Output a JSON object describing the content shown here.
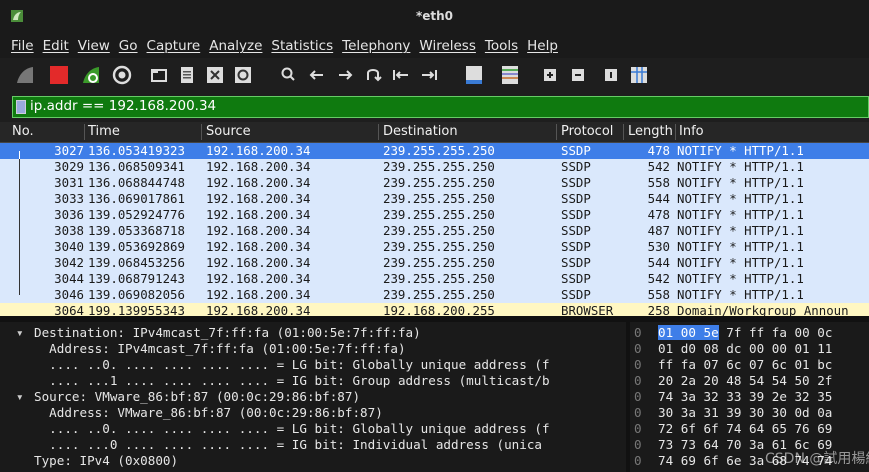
{
  "window": {
    "title": "*eth0"
  },
  "menu": [
    "File",
    "Edit",
    "View",
    "Go",
    "Capture",
    "Analyze",
    "Statistics",
    "Telephony",
    "Wireless",
    "Tools",
    "Help"
  ],
  "filter": {
    "value": "ip.addr == 192.168.200.34"
  },
  "columns": {
    "no": "No.",
    "time": "Time",
    "source": "Source",
    "destination": "Destination",
    "protocol": "Protocol",
    "length": "Length",
    "info": "Info"
  },
  "packets": [
    {
      "no": "3027",
      "time": "136.053419323",
      "source": "192.168.200.34",
      "destination": "239.255.255.250",
      "protocol": "SSDP",
      "length": "478",
      "info": "NOTIFY * HTTP/1.1"
    },
    {
      "no": "3029",
      "time": "136.068509341",
      "source": "192.168.200.34",
      "destination": "239.255.255.250",
      "protocol": "SSDP",
      "length": "542",
      "info": "NOTIFY * HTTP/1.1"
    },
    {
      "no": "3031",
      "time": "136.068844748",
      "source": "192.168.200.34",
      "destination": "239.255.255.250",
      "protocol": "SSDP",
      "length": "558",
      "info": "NOTIFY * HTTP/1.1"
    },
    {
      "no": "3033",
      "time": "136.069017861",
      "source": "192.168.200.34",
      "destination": "239.255.255.250",
      "protocol": "SSDP",
      "length": "544",
      "info": "NOTIFY * HTTP/1.1"
    },
    {
      "no": "3036",
      "time": "139.052924776",
      "source": "192.168.200.34",
      "destination": "239.255.255.250",
      "protocol": "SSDP",
      "length": "478",
      "info": "NOTIFY * HTTP/1.1"
    },
    {
      "no": "3038",
      "time": "139.053368718",
      "source": "192.168.200.34",
      "destination": "239.255.255.250",
      "protocol": "SSDP",
      "length": "487",
      "info": "NOTIFY * HTTP/1.1"
    },
    {
      "no": "3040",
      "time": "139.053692869",
      "source": "192.168.200.34",
      "destination": "239.255.255.250",
      "protocol": "SSDP",
      "length": "530",
      "info": "NOTIFY * HTTP/1.1"
    },
    {
      "no": "3042",
      "time": "139.068453256",
      "source": "192.168.200.34",
      "destination": "239.255.255.250",
      "protocol": "SSDP",
      "length": "544",
      "info": "NOTIFY * HTTP/1.1"
    },
    {
      "no": "3044",
      "time": "139.068791243",
      "source": "192.168.200.34",
      "destination": "239.255.255.250",
      "protocol": "SSDP",
      "length": "542",
      "info": "NOTIFY * HTTP/1.1"
    },
    {
      "no": "3046",
      "time": "139.069082056",
      "source": "192.168.200.34",
      "destination": "239.255.255.250",
      "protocol": "SSDP",
      "length": "558",
      "info": "NOTIFY * HTTP/1.1"
    },
    {
      "no": "3064",
      "time": "199.139955343",
      "source": "192.168.200.34",
      "destination": "192.168.200.255",
      "protocol": "BROWSER",
      "length": "258",
      "info": "Domain/Workgroup Announ"
    }
  ],
  "details": [
    {
      "arrow": "▾",
      "text": "Destination: IPv4mcast_7f:ff:fa (01:00:5e:7f:ff:fa)"
    },
    {
      "arrow": "",
      "text": "  Address: IPv4mcast_7f:ff:fa (01:00:5e:7f:ff:fa)"
    },
    {
      "arrow": "",
      "text": "  .... ..0. .... .... .... .... = LG bit: Globally unique address (f"
    },
    {
      "arrow": "",
      "text": "  .... ...1 .... .... .... .... = IG bit: Group address (multicast/b"
    },
    {
      "arrow": "▾",
      "text": "Source: VMware_86:bf:87 (00:0c:29:86:bf:87)"
    },
    {
      "arrow": "",
      "text": "  Address: VMware_86:bf:87 (00:0c:29:86:bf:87)"
    },
    {
      "arrow": "",
      "text": "  .... ..0. .... .... .... .... = LG bit: Globally unique address (f"
    },
    {
      "arrow": "",
      "text": "  .... ...0 .... .... .... .... = IG bit: Individual address (unica"
    },
    {
      "arrow": "",
      "text": "Type: IPv4 (0x0800)"
    }
  ],
  "hex": [
    {
      "offset": "0",
      "hl": "01 00 5e",
      "bytes": " 7f ff fa 00 0c"
    },
    {
      "offset": "0",
      "hl": "",
      "bytes": "01 d0 08 dc 00 00 01 11"
    },
    {
      "offset": "0",
      "hl": "",
      "bytes": "ff fa 07 6c 07 6c 01 bc"
    },
    {
      "offset": "0",
      "hl": "",
      "bytes": "20 2a 20 48 54 54 50 2f"
    },
    {
      "offset": "0",
      "hl": "",
      "bytes": "74 3a 32 33 39 2e 32 35"
    },
    {
      "offset": "0",
      "hl": "",
      "bytes": "30 3a 31 39 30 30 0d 0a"
    },
    {
      "offset": "0",
      "hl": "",
      "bytes": "72 6f 6f 74 64 65 76 69"
    },
    {
      "offset": "0",
      "hl": "",
      "bytes": "73 73 64 70 3a 61 6c 69"
    },
    {
      "offset": "0",
      "hl": "",
      "bytes": "74 69 6f 6e 3a 68 74 74"
    }
  ],
  "watermark": "CSDN @試用楊紅"
}
